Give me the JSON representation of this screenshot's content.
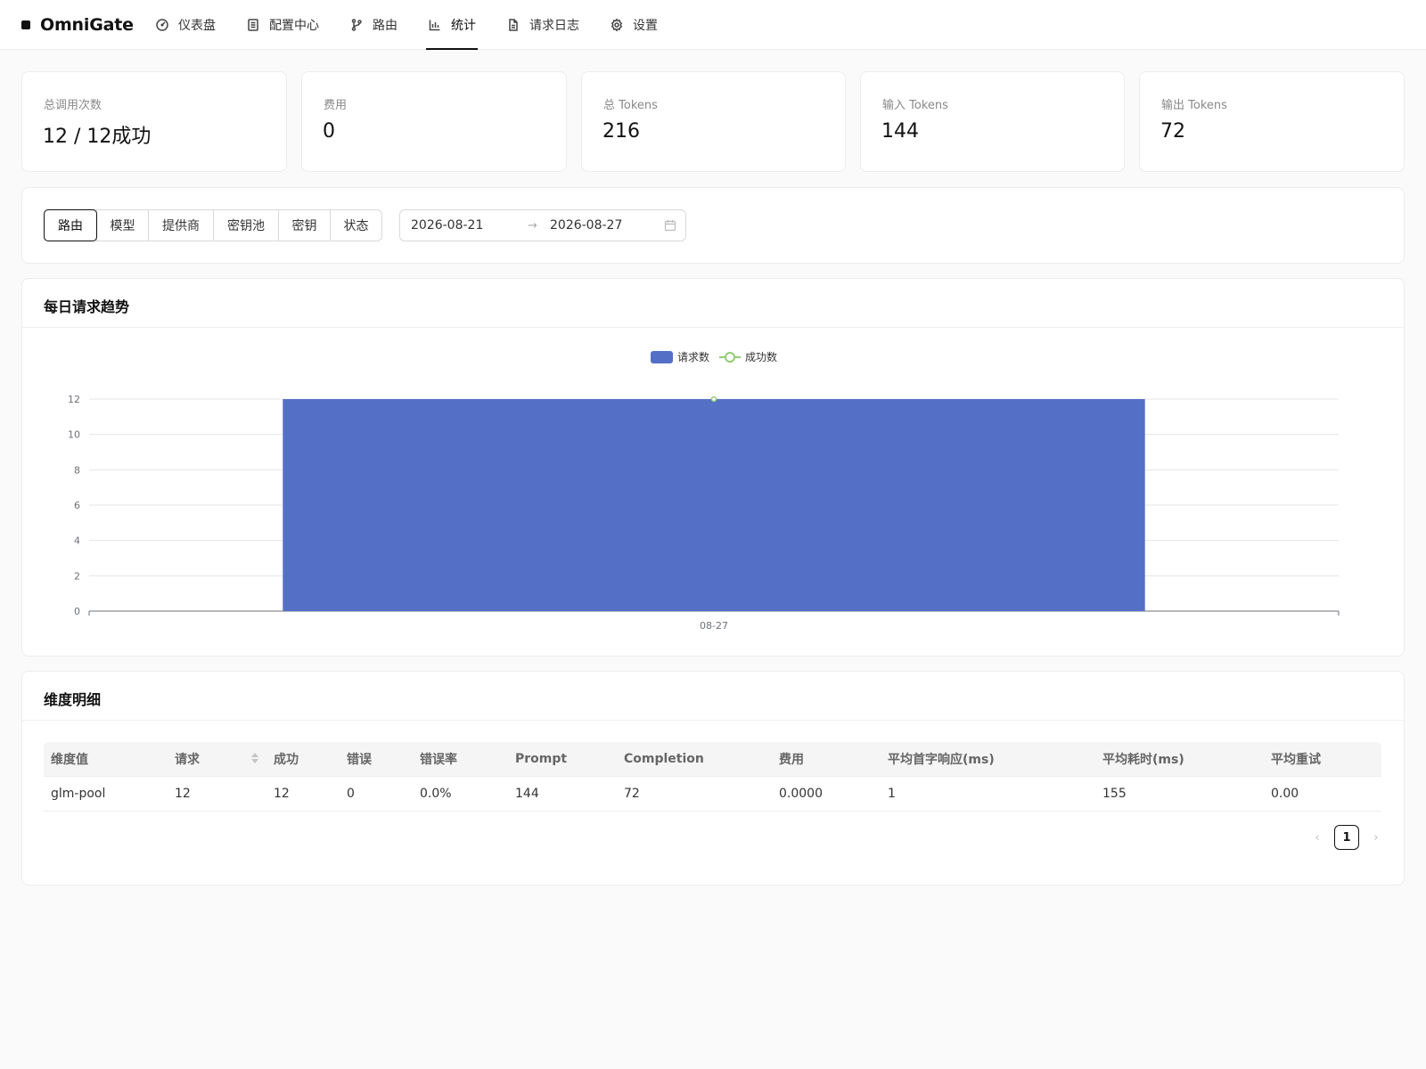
{
  "app": {
    "name": "OmniGate"
  },
  "nav": [
    {
      "label": "仪表盘",
      "icon": "dashboard-icon"
    },
    {
      "label": "配置中心",
      "icon": "config-icon"
    },
    {
      "label": "路由",
      "icon": "route-icon"
    },
    {
      "label": "统计",
      "icon": "bar-chart-icon",
      "active": true
    },
    {
      "label": "请求日志",
      "icon": "log-file-icon"
    },
    {
      "label": "设置",
      "icon": "gear-icon"
    }
  ],
  "stats": [
    {
      "label": "总调用次数",
      "value": "12 / 12成功"
    },
    {
      "label": "费用",
      "value": "0"
    },
    {
      "label": "总 Tokens",
      "value": "216"
    },
    {
      "label": "输入 Tokens",
      "value": "144"
    },
    {
      "label": "输出 Tokens",
      "value": "72"
    }
  ],
  "filters": {
    "dimensions": [
      "路由",
      "模型",
      "提供商",
      "密钥池",
      "密钥",
      "状态"
    ],
    "active_dimension": "路由",
    "date_start": "2026-08-21",
    "date_arrow": "→",
    "date_end": "2026-08-27"
  },
  "trend": {
    "title": "每日请求趋势"
  },
  "chart_data": {
    "type": "bar",
    "categories": [
      "08-27"
    ],
    "series": [
      {
        "name": "请求数",
        "type": "bar",
        "values": [
          12
        ],
        "color": "#5470c6"
      },
      {
        "name": "成功数",
        "type": "line",
        "values": [
          12
        ],
        "color": "#91cc75"
      }
    ],
    "ylim": [
      0,
      12
    ],
    "yticks": [
      0,
      2,
      4,
      6,
      8,
      10,
      12
    ],
    "grid": true,
    "legend": "top-center"
  },
  "detail": {
    "title": "维度明细",
    "columns": [
      "维度值",
      "请求",
      "成功",
      "错误",
      "错误率",
      "Prompt",
      "Completion",
      "费用",
      "平均首字响应(ms)",
      "平均耗时(ms)",
      "平均重试"
    ],
    "rows": [
      [
        "glm-pool",
        "12",
        "12",
        "0",
        "0.0%",
        "144",
        "72",
        "0.0000",
        "1",
        "155",
        "0.00"
      ]
    ],
    "pagination": {
      "prev": "‹",
      "current": "1",
      "next": "›"
    }
  }
}
